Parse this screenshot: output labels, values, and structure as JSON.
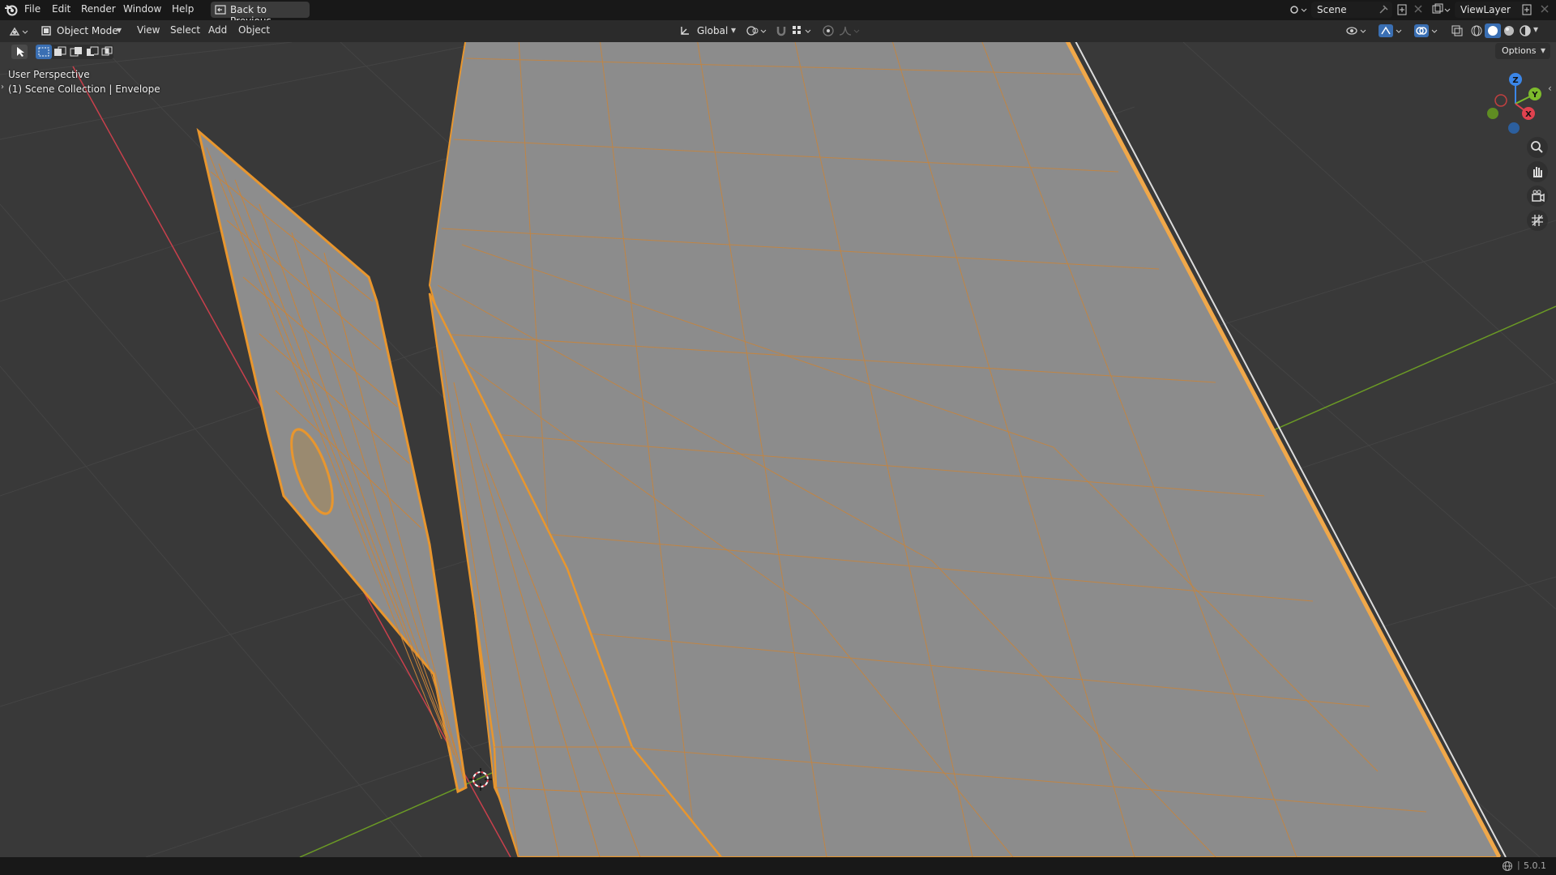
{
  "menu": {
    "file": "File",
    "edit": "Edit",
    "render": "Render",
    "window": "Window",
    "help": "Help",
    "back_button": "Back to Previous"
  },
  "scene": {
    "name": "Scene",
    "view_layer": "ViewLayer"
  },
  "header": {
    "mode": "Object Mode",
    "view": "View",
    "select": "Select",
    "add": "Add",
    "object": "Object",
    "transform_orientation": "Global",
    "options": "Options"
  },
  "viewport": {
    "perspective": "User Perspective",
    "collection": "(1) Scene Collection | Envelope",
    "gizmo": {
      "x": "X",
      "y": "Y",
      "z": "Z"
    }
  },
  "status": {
    "version": "5.0.1"
  },
  "colors": {
    "selection_orange": "#e8962e",
    "viewport_bg": "#393939",
    "mesh_gray": "#8d8d8d",
    "x_axis": "#e0424f",
    "y_axis": "#7dbb2c",
    "z_axis": "#3b86e8"
  },
  "icons": {
    "app": "blender-logo-icon",
    "back": "back-arrow-icon",
    "zoom": "zoom-icon",
    "pan": "hand-icon",
    "camera": "camera-icon",
    "ortho": "grid-icon"
  }
}
